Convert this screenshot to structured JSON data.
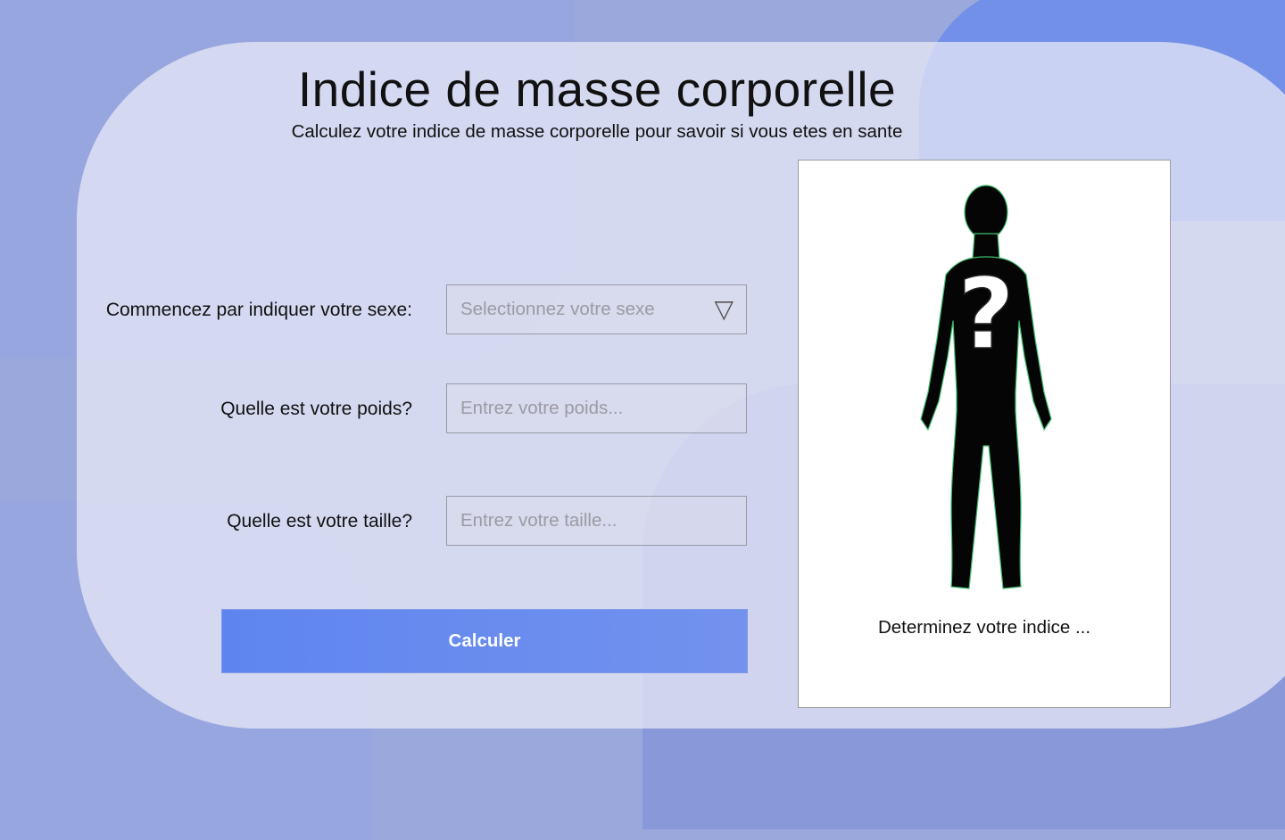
{
  "header": {
    "title": "Indice de masse corporelle",
    "subtitle": "Calculez votre indice de masse corporelle pour savoir si vous etes en sante"
  },
  "form": {
    "sex_label": "Commencez par indiquer votre sexe:",
    "sex_placeholder": "Selectionnez votre sexe",
    "weight_label": "Quelle est votre poids?",
    "weight_placeholder": "Entrez votre poids...",
    "height_label": "Quelle est votre taille?",
    "height_placeholder": "Entrez votre taille...",
    "submit_label": "Calculer"
  },
  "result": {
    "image_icon": "unknown-person-silhouette-icon",
    "question_mark": "?",
    "text": "Determinez votre indice ..."
  },
  "colors": {
    "accent": "#6689ef",
    "background": "#9aa8dc"
  },
  "icons": {
    "dropdown_icon": "triangle-down-icon",
    "dropdown_glyph": "▽"
  }
}
